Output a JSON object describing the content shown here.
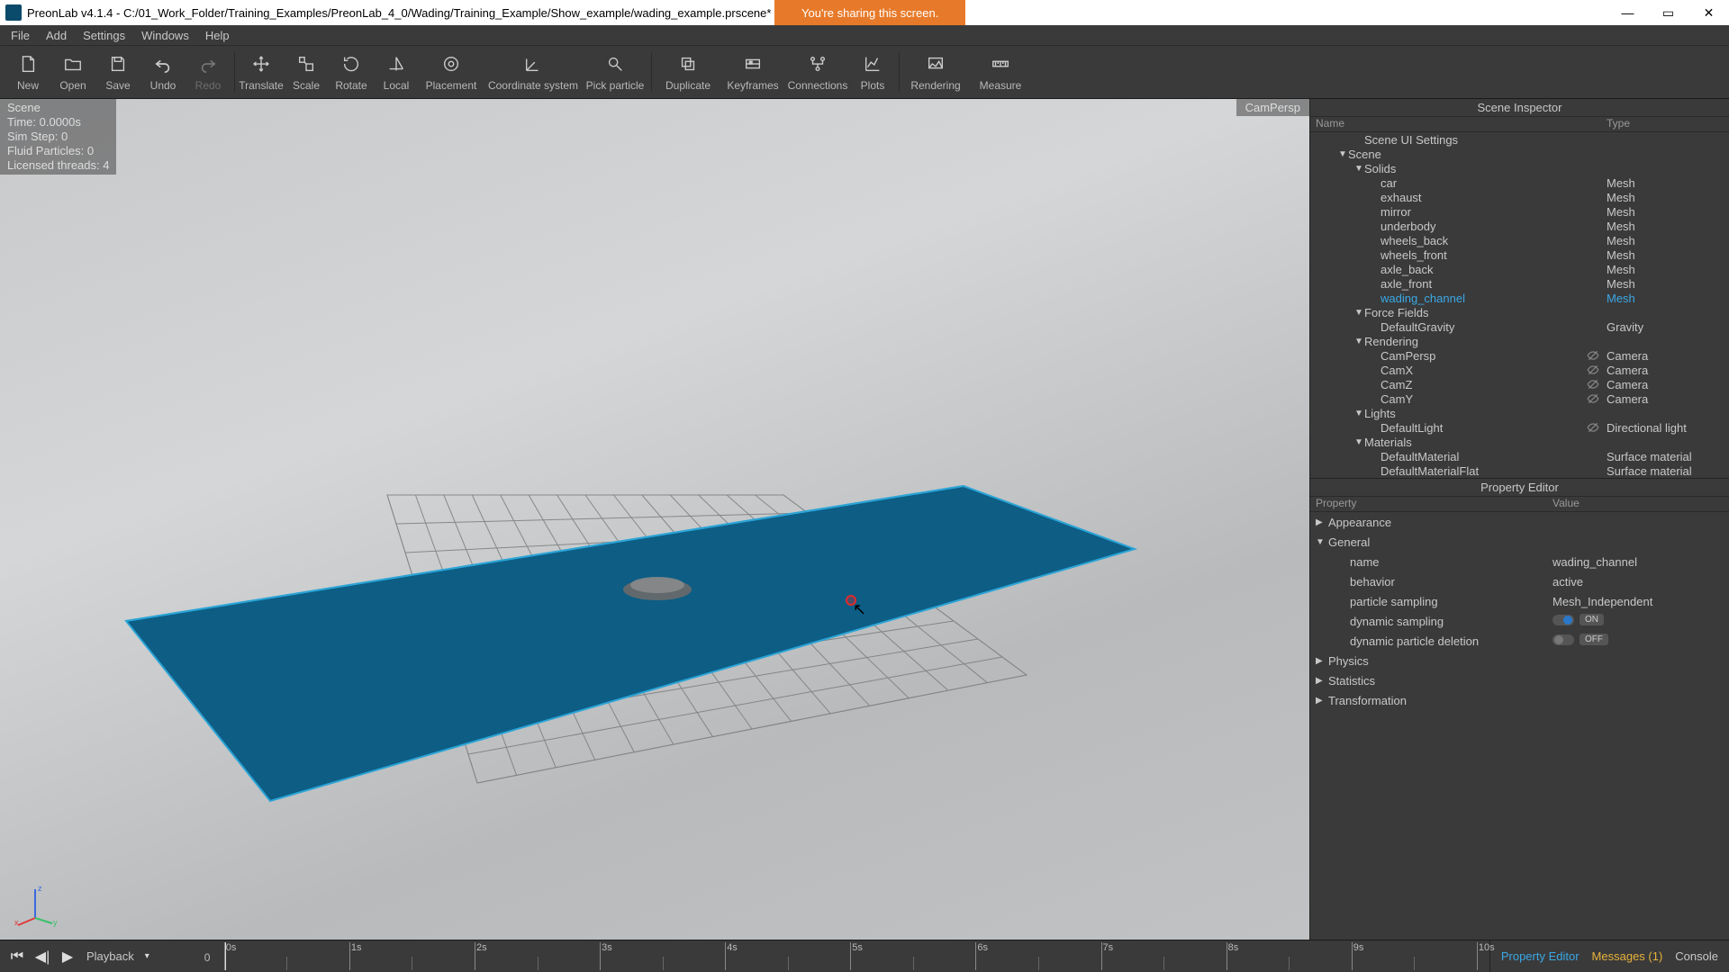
{
  "title": "PreonLab v4.1.4 - C:/01_Work_Folder/Training_Examples/PreonLab_4_0/Wading/Training_Example/Show_example/wading_example.prscene*",
  "share_banner": "You're sharing this screen.",
  "menu": [
    "File",
    "Add",
    "Settings",
    "Windows",
    "Help"
  ],
  "toolbar": [
    {
      "label": "New",
      "icon": "new"
    },
    {
      "label": "Open",
      "icon": "open"
    },
    {
      "label": "Save",
      "icon": "save"
    },
    {
      "label": "Undo",
      "icon": "undo"
    },
    {
      "label": "Redo",
      "icon": "redo",
      "disabled": true
    },
    {
      "sep": true
    },
    {
      "label": "Translate",
      "icon": "translate"
    },
    {
      "label": "Scale",
      "icon": "scale"
    },
    {
      "label": "Rotate",
      "icon": "rotate"
    },
    {
      "label": "Local",
      "icon": "local"
    },
    {
      "label": "Placement",
      "icon": "placement",
      "wide": "med"
    },
    {
      "label": "Coordinate system",
      "icon": "coord",
      "wide": "wide"
    },
    {
      "label": "Pick particle",
      "icon": "pick",
      "wide": "med"
    },
    {
      "sep": true
    },
    {
      "label": "Duplicate",
      "icon": "duplicate",
      "wide": "med"
    },
    {
      "label": "Keyframes",
      "icon": "keyframes",
      "wide": "med"
    },
    {
      "label": "Connections",
      "icon": "connections",
      "wide": "med"
    },
    {
      "label": "Plots",
      "icon": "plots"
    },
    {
      "sep": true
    },
    {
      "label": "Rendering",
      "icon": "rendering",
      "wide": "med"
    },
    {
      "label": "Measure",
      "icon": "measure",
      "wide": "med"
    }
  ],
  "viewport": {
    "overlay": {
      "scene": "Scene",
      "time": "Time: 0.0000s",
      "step": "Sim Step: 0",
      "particles": "Fluid Particles: 0",
      "threads": "Licensed threads: 4"
    },
    "camera_label": "CamPersp"
  },
  "inspector": {
    "title": "Scene Inspector",
    "headers": {
      "name": "Name",
      "type": "Type"
    },
    "tree": [
      {
        "ind": 2,
        "label": "Scene UI Settings",
        "arrow": ""
      },
      {
        "ind": 1,
        "label": "Scene",
        "arrow": "▼"
      },
      {
        "ind": 2,
        "label": "Solids",
        "arrow": "▼"
      },
      {
        "ind": 3,
        "label": "car",
        "type": "Mesh"
      },
      {
        "ind": 3,
        "label": "exhaust",
        "type": "Mesh"
      },
      {
        "ind": 3,
        "label": "mirror",
        "type": "Mesh"
      },
      {
        "ind": 3,
        "label": "underbody",
        "type": "Mesh"
      },
      {
        "ind": 3,
        "label": "wheels_back",
        "type": "Mesh"
      },
      {
        "ind": 3,
        "label": "wheels_front",
        "type": "Mesh"
      },
      {
        "ind": 3,
        "label": "axle_back",
        "type": "Mesh"
      },
      {
        "ind": 3,
        "label": "axle_front",
        "type": "Mesh"
      },
      {
        "ind": 3,
        "label": "wading_channel",
        "type": "Mesh",
        "selected": true
      },
      {
        "ind": 2,
        "label": "Force Fields",
        "arrow": "▼"
      },
      {
        "ind": 3,
        "label": "DefaultGravity",
        "type": "Gravity"
      },
      {
        "ind": 2,
        "label": "Rendering",
        "arrow": "▼"
      },
      {
        "ind": 3,
        "label": "CamPersp",
        "type": "Camera",
        "eye": true
      },
      {
        "ind": 3,
        "label": "CamX",
        "type": "Camera",
        "eye": true
      },
      {
        "ind": 3,
        "label": "CamZ",
        "type": "Camera",
        "eye": true
      },
      {
        "ind": 3,
        "label": "CamY",
        "type": "Camera",
        "eye": true
      },
      {
        "ind": 2,
        "label": "Lights",
        "arrow": "▼"
      },
      {
        "ind": 3,
        "label": "DefaultLight",
        "type": "Directional light",
        "eye": true
      },
      {
        "ind": 2,
        "label": "Materials",
        "arrow": "▼"
      },
      {
        "ind": 3,
        "label": "DefaultMaterial",
        "type": "Surface material"
      },
      {
        "ind": 3,
        "label": "DefaultMaterialFlat",
        "type": "Surface material"
      }
    ]
  },
  "property_editor": {
    "title": "Property Editor",
    "headers": {
      "prop": "Property",
      "val": "Value"
    },
    "groups": [
      {
        "label": "Appearance",
        "open": false
      },
      {
        "label": "General",
        "open": true,
        "items": [
          {
            "label": "name",
            "value": "wading_channel"
          },
          {
            "label": "behavior",
            "value": "active"
          },
          {
            "label": "particle sampling",
            "value": "Mesh_Independent"
          },
          {
            "label": "dynamic sampling",
            "value": "ON",
            "toggle": true,
            "on": true
          },
          {
            "label": "dynamic particle deletion",
            "value": "OFF",
            "toggle": true,
            "on": false
          }
        ]
      },
      {
        "label": "Physics",
        "open": false
      },
      {
        "label": "Statistics",
        "open": false
      },
      {
        "label": "Transformation",
        "open": false
      }
    ]
  },
  "timeline": {
    "zero_label": "0",
    "playback_label": "Playback",
    "ticks": [
      "0s",
      "1s",
      "2s",
      "3s",
      "4s",
      "5s",
      "6s",
      "7s",
      "8s",
      "9s",
      "10s"
    ]
  },
  "bottom_tabs": {
    "prop": "Property Editor",
    "msg": "Messages (1)",
    "console": "Console"
  }
}
